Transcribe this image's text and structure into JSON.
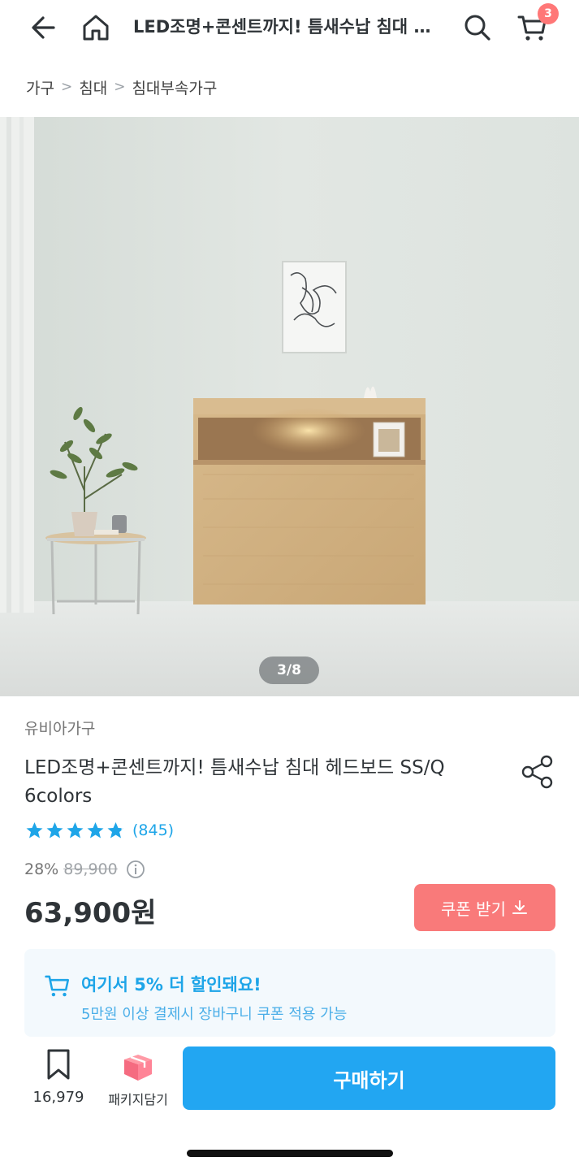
{
  "header": {
    "title": "LED조명+콘센트까지! 틈새수납 침대 헤드보드 SS/Q 6colors",
    "cart_count": "3"
  },
  "breadcrumb": [
    "가구",
    "침대",
    "침대부속가구"
  ],
  "gallery": {
    "counter": "3/8",
    "current": 3,
    "total": 8
  },
  "product": {
    "brand": "유비아가구",
    "name": "LED조명+콘센트까지! 틈새수납 침대 헤드보드 SS/Q 6colors",
    "rating_stars": 4.8,
    "review_count": "(845)",
    "discount": "28%",
    "original_price": "89,900",
    "price": "63,900원"
  },
  "coupon": {
    "label": "쿠폰 받기"
  },
  "promo": {
    "title": "여기서 5% 더 할인돼요!",
    "subtitle": "5만원 이상 결제시 장바구니 쿠폰 적용 가능"
  },
  "bottom_bar": {
    "bookmark_count": "16,979",
    "package_label": "패키지담기",
    "buy_label": "구매하기"
  },
  "colors": {
    "accent": "#22a6f2",
    "coupon": "#f97a7a",
    "badge": "#ff7777",
    "promo_bg": "#f3f9fd"
  }
}
